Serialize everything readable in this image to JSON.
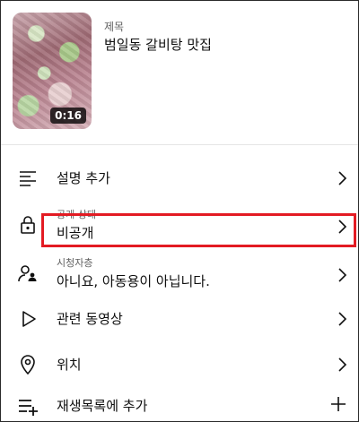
{
  "header": {
    "title_label": "제목",
    "title_value": "범일동 갈비탕 맛집",
    "duration": "0:16"
  },
  "rows": {
    "description": {
      "label": "설명 추가",
      "icon": "description-icon"
    },
    "visibility": {
      "label_small": "공개 상태",
      "value": "비공개",
      "icon": "lock-icon"
    },
    "audience": {
      "label_small": "시청자층",
      "value": "아니요, 아동용이 아닙니다.",
      "icon": "audience-icon"
    },
    "related": {
      "label": "관련 동영상",
      "icon": "play-icon"
    },
    "location": {
      "label": "위치",
      "icon": "location-icon"
    },
    "playlist": {
      "label": "재생목록에 추가",
      "icon": "playlist-add-icon"
    }
  },
  "colors": {
    "highlight": "#e31b23",
    "text": "#0f0f0f",
    "secondary": "#606060"
  }
}
